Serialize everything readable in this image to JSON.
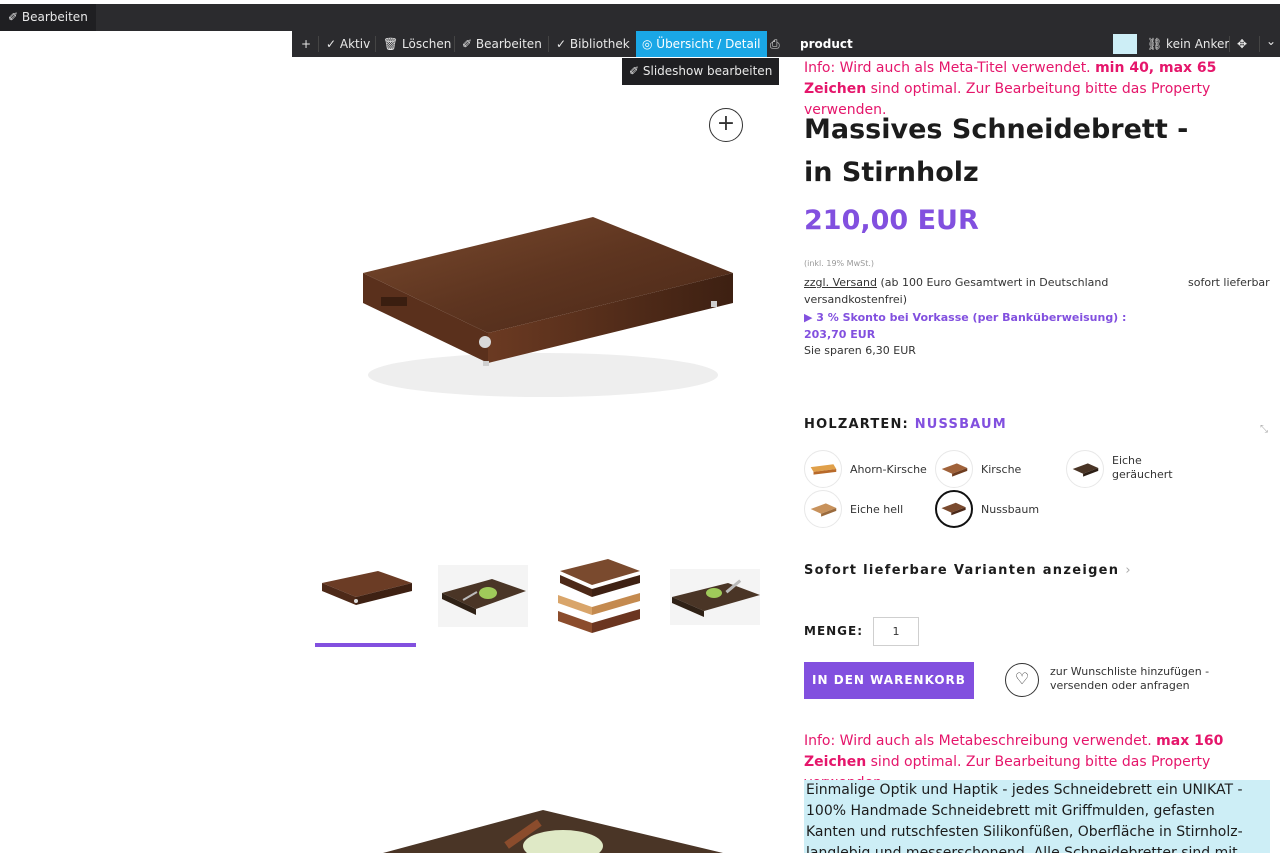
{
  "topbar": {
    "edit_label": "✐ Bearbeiten"
  },
  "toolbar": {
    "add": "+",
    "aktiv": "✓ Aktiv",
    "loeschen": "🗑 Löschen",
    "bearbeiten": "✐ Bearbeiten",
    "bibliothek": "✓ Bibliothek",
    "uebersicht": "◎ Übersicht / Detail",
    "print": "⎙",
    "product": "product",
    "anker": "⛓ kein Anker",
    "move": "✥",
    "chevron": "⌄",
    "swatch_color": "#cdeef6"
  },
  "dropdown": {
    "slideshow": "✐ Slideshow bearbeiten"
  },
  "gallery": {
    "zoom": "+",
    "accent_color": "#8250df"
  },
  "product": {
    "info_meta_title_pre": "Info: Wird auch als Meta-Titel verwendet. ",
    "info_meta_title_bold": "min 40, max 65 Zeichen",
    "info_meta_title_post": " sind optimal. Zur Bearbeitung bitte das Property verwenden.",
    "title": "Massives Schneidebrett - in Stirnholz",
    "price": "210,00 EUR",
    "tax": "(inkl. 19% MwSt.)",
    "shipping_link": "zzgl. Versand",
    "shipping_text": " (ab 100 Euro Gesamtwert in Deutschland versandkostenfrei)",
    "availability": "sofort lieferbar",
    "skonto": "▶  3 % Skonto bei Vorkasse (per Banküberweisung) : 203,70 EUR",
    "savings": "Sie sparen 6,30 EUR"
  },
  "wood": {
    "heading": "HOLZARTEN: ",
    "selected": "NUSSBAUM",
    "options": [
      {
        "label": "Ahorn-Kirsche"
      },
      {
        "label": "Kirsche"
      },
      {
        "label": "Eiche geräuchert"
      },
      {
        "label": "Eiche hell"
      },
      {
        "label": "Nussbaum"
      }
    ]
  },
  "variants": {
    "label": "Sofort lieferbare Varianten anzeigen",
    "chevron": "›"
  },
  "quantity": {
    "label": "MENGE:",
    "value": "1"
  },
  "cart": {
    "label": "IN DEN WARENKORB"
  },
  "wishlist": {
    "icon": "♡",
    "text": "zur Wunschliste hinzufügen - versenden oder anfragen"
  },
  "description": {
    "info_pre": "Info: Wird auch als Metabeschreibung verwendet. ",
    "info_bold": "max 160 Zeichen",
    "info_post": " sind optimal. Zur Bearbeitung bitte das Property verwenden",
    "text": "Einmalige Optik und Haptik - jedes Schneidebrett ein UNIKAT - 100% Handmade Schneidebrett mit Griffmulden, gefasten Kanten und rutschfesten Silikonfüßen, Oberfläche in Stirnholz- langlebig und messerschonend. Alle Schneidebretter sind mit einer Mischung aus"
  }
}
